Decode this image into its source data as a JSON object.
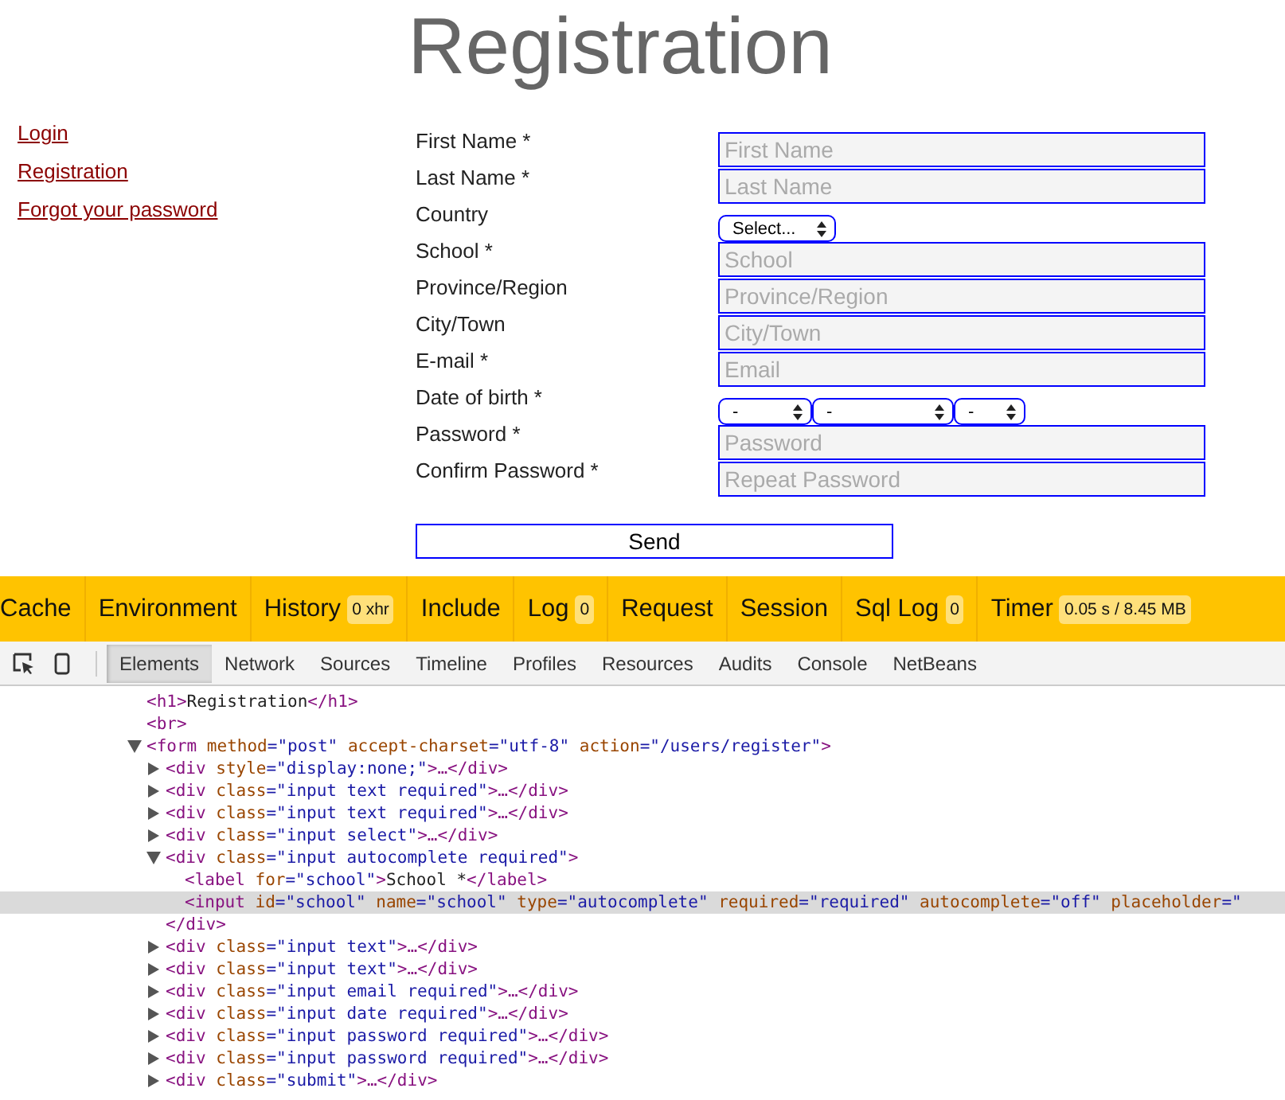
{
  "page_title": "Registration",
  "side_links": [
    "Login",
    "Registration",
    "Forgot your password"
  ],
  "form": {
    "fields": [
      {
        "label": "First Name *",
        "kind": "text",
        "placeholder": "First Name"
      },
      {
        "label": "Last Name *",
        "kind": "text",
        "placeholder": "Last Name"
      },
      {
        "label": "Country",
        "kind": "select",
        "selects": [
          "Select..."
        ]
      },
      {
        "label": "School *",
        "kind": "text",
        "placeholder": "School"
      },
      {
        "label": "Province/Region",
        "kind": "text",
        "placeholder": "Province/Region"
      },
      {
        "label": "City/Town",
        "kind": "text",
        "placeholder": "City/Town"
      },
      {
        "label": "E-mail *",
        "kind": "text",
        "placeholder": "Email"
      },
      {
        "label": "Date of birth *",
        "kind": "select",
        "selects": [
          "-",
          "-",
          "-"
        ]
      },
      {
        "label": "Password *",
        "kind": "text",
        "placeholder": "Password"
      },
      {
        "label": "Confirm Password *",
        "kind": "text",
        "placeholder": "Repeat Password"
      }
    ],
    "submit": "Send"
  },
  "debug_bar": [
    {
      "label": "Cache"
    },
    {
      "label": "Environment"
    },
    {
      "label": "History",
      "badge": "0 xhr"
    },
    {
      "label": "Include"
    },
    {
      "label": "Log",
      "badge": "0"
    },
    {
      "label": "Request"
    },
    {
      "label": "Session"
    },
    {
      "label": "Sql Log",
      "badge": "0"
    },
    {
      "label": "Timer",
      "badge": "0.05 s / 8.45 MB"
    }
  ],
  "devtools": {
    "tabs": [
      {
        "label": "Elements",
        "selected": true
      },
      {
        "label": "Network",
        "selected": false
      },
      {
        "label": "Sources",
        "selected": false
      },
      {
        "label": "Timeline",
        "selected": false
      },
      {
        "label": "Profiles",
        "selected": false
      },
      {
        "label": "Resources",
        "selected": false
      },
      {
        "label": "Audits",
        "selected": false
      },
      {
        "label": "Console",
        "selected": false
      },
      {
        "label": "NetBeans",
        "selected": false
      }
    ],
    "dom_tree": [
      {
        "selected": false,
        "parts": [
          {
            "kind": "tag",
            "text": "<h1>"
          },
          {
            "kind": "text",
            "text": "Registration"
          },
          {
            "kind": "tag",
            "text": "</h1>"
          }
        ]
      },
      {
        "selected": false,
        "parts": [
          {
            "kind": "tag",
            "text": "<br>"
          }
        ]
      },
      {
        "selected": false,
        "expanded": true,
        "parts": [
          {
            "kind": "tag",
            "text": "<form"
          },
          {
            "kind": "attr",
            "text": " method"
          },
          {
            "kind": "value",
            "text": "=\"post\""
          },
          {
            "kind": "attr",
            "text": " accept-charset"
          },
          {
            "kind": "value",
            "text": "=\"utf-8\""
          },
          {
            "kind": "attr",
            "text": " action"
          },
          {
            "kind": "value",
            "text": "=\"/users/register\""
          },
          {
            "kind": "tag",
            "text": ">"
          }
        ],
        "children": [
          {
            "selected": false,
            "expanded": false,
            "parts": [
              {
                "kind": "tag",
                "text": "<div"
              },
              {
                "kind": "attr",
                "text": " style"
              },
              {
                "kind": "value",
                "text": "=\"display:none;\""
              },
              {
                "kind": "tag",
                "text": ">…</div>"
              }
            ]
          },
          {
            "selected": false,
            "expanded": false,
            "parts": [
              {
                "kind": "tag",
                "text": "<div"
              },
              {
                "kind": "attr",
                "text": " class"
              },
              {
                "kind": "value",
                "text": "=\"input text required\""
              },
              {
                "kind": "tag",
                "text": ">…</div>"
              }
            ]
          },
          {
            "selected": false,
            "expanded": false,
            "parts": [
              {
                "kind": "tag",
                "text": "<div"
              },
              {
                "kind": "attr",
                "text": " class"
              },
              {
                "kind": "value",
                "text": "=\"input text required\""
              },
              {
                "kind": "tag",
                "text": ">…</div>"
              }
            ]
          },
          {
            "selected": false,
            "expanded": false,
            "parts": [
              {
                "kind": "tag",
                "text": "<div"
              },
              {
                "kind": "attr",
                "text": " class"
              },
              {
                "kind": "value",
                "text": "=\"input select\""
              },
              {
                "kind": "tag",
                "text": ">…</div>"
              }
            ]
          },
          {
            "selected": false,
            "expanded": true,
            "parts": [
              {
                "kind": "tag",
                "text": "<div"
              },
              {
                "kind": "attr",
                "text": " class"
              },
              {
                "kind": "value",
                "text": "=\"input autocomplete required\""
              },
              {
                "kind": "tag",
                "text": ">"
              }
            ],
            "closing": "</div>",
            "children": [
              {
                "selected": false,
                "parts": [
                  {
                    "kind": "tag",
                    "text": "<label"
                  },
                  {
                    "kind": "attr",
                    "text": " for"
                  },
                  {
                    "kind": "value",
                    "text": "=\"school\""
                  },
                  {
                    "kind": "tag",
                    "text": ">"
                  },
                  {
                    "kind": "text",
                    "text": "School *"
                  },
                  {
                    "kind": "tag",
                    "text": "</label>"
                  }
                ]
              },
              {
                "selected": true,
                "parts": [
                  {
                    "kind": "tag",
                    "text": "<input"
                  },
                  {
                    "kind": "attr",
                    "text": " id"
                  },
                  {
                    "kind": "value",
                    "text": "=\"school\""
                  },
                  {
                    "kind": "attr",
                    "text": " name"
                  },
                  {
                    "kind": "value",
                    "text": "=\"school\""
                  },
                  {
                    "kind": "attr",
                    "text": " type"
                  },
                  {
                    "kind": "value",
                    "text": "=\"autocomplete\""
                  },
                  {
                    "kind": "attr",
                    "text": " required"
                  },
                  {
                    "kind": "value",
                    "text": "=\"required\""
                  },
                  {
                    "kind": "attr",
                    "text": " autocomplete"
                  },
                  {
                    "kind": "value",
                    "text": "=\"off\""
                  },
                  {
                    "kind": "attr",
                    "text": " placeholder"
                  },
                  {
                    "kind": "value",
                    "text": "=\""
                  }
                ]
              }
            ]
          },
          {
            "selected": false,
            "expanded": false,
            "parts": [
              {
                "kind": "tag",
                "text": "<div"
              },
              {
                "kind": "attr",
                "text": " class"
              },
              {
                "kind": "value",
                "text": "=\"input text\""
              },
              {
                "kind": "tag",
                "text": ">…</div>"
              }
            ]
          },
          {
            "selected": false,
            "expanded": false,
            "parts": [
              {
                "kind": "tag",
                "text": "<div"
              },
              {
                "kind": "attr",
                "text": " class"
              },
              {
                "kind": "value",
                "text": "=\"input text\""
              },
              {
                "kind": "tag",
                "text": ">…</div>"
              }
            ]
          },
          {
            "selected": false,
            "expanded": false,
            "parts": [
              {
                "kind": "tag",
                "text": "<div"
              },
              {
                "kind": "attr",
                "text": " class"
              },
              {
                "kind": "value",
                "text": "=\"input email required\""
              },
              {
                "kind": "tag",
                "text": ">…</div>"
              }
            ]
          },
          {
            "selected": false,
            "expanded": false,
            "parts": [
              {
                "kind": "tag",
                "text": "<div"
              },
              {
                "kind": "attr",
                "text": " class"
              },
              {
                "kind": "value",
                "text": "=\"input date required\""
              },
              {
                "kind": "tag",
                "text": ">…</div>"
              }
            ]
          },
          {
            "selected": false,
            "expanded": false,
            "parts": [
              {
                "kind": "tag",
                "text": "<div"
              },
              {
                "kind": "attr",
                "text": " class"
              },
              {
                "kind": "value",
                "text": "=\"input password required\""
              },
              {
                "kind": "tag",
                "text": ">…</div>"
              }
            ]
          },
          {
            "selected": false,
            "expanded": false,
            "parts": [
              {
                "kind": "tag",
                "text": "<div"
              },
              {
                "kind": "attr",
                "text": " class"
              },
              {
                "kind": "value",
                "text": "=\"input password required\""
              },
              {
                "kind": "tag",
                "text": ">…</div>"
              }
            ]
          },
          {
            "selected": false,
            "expanded": false,
            "parts": [
              {
                "kind": "tag",
                "text": "<div"
              },
              {
                "kind": "attr",
                "text": " class"
              },
              {
                "kind": "value",
                "text": "=\"submit\""
              },
              {
                "kind": "tag",
                "text": ">…</div>"
              }
            ]
          }
        ]
      }
    ]
  }
}
